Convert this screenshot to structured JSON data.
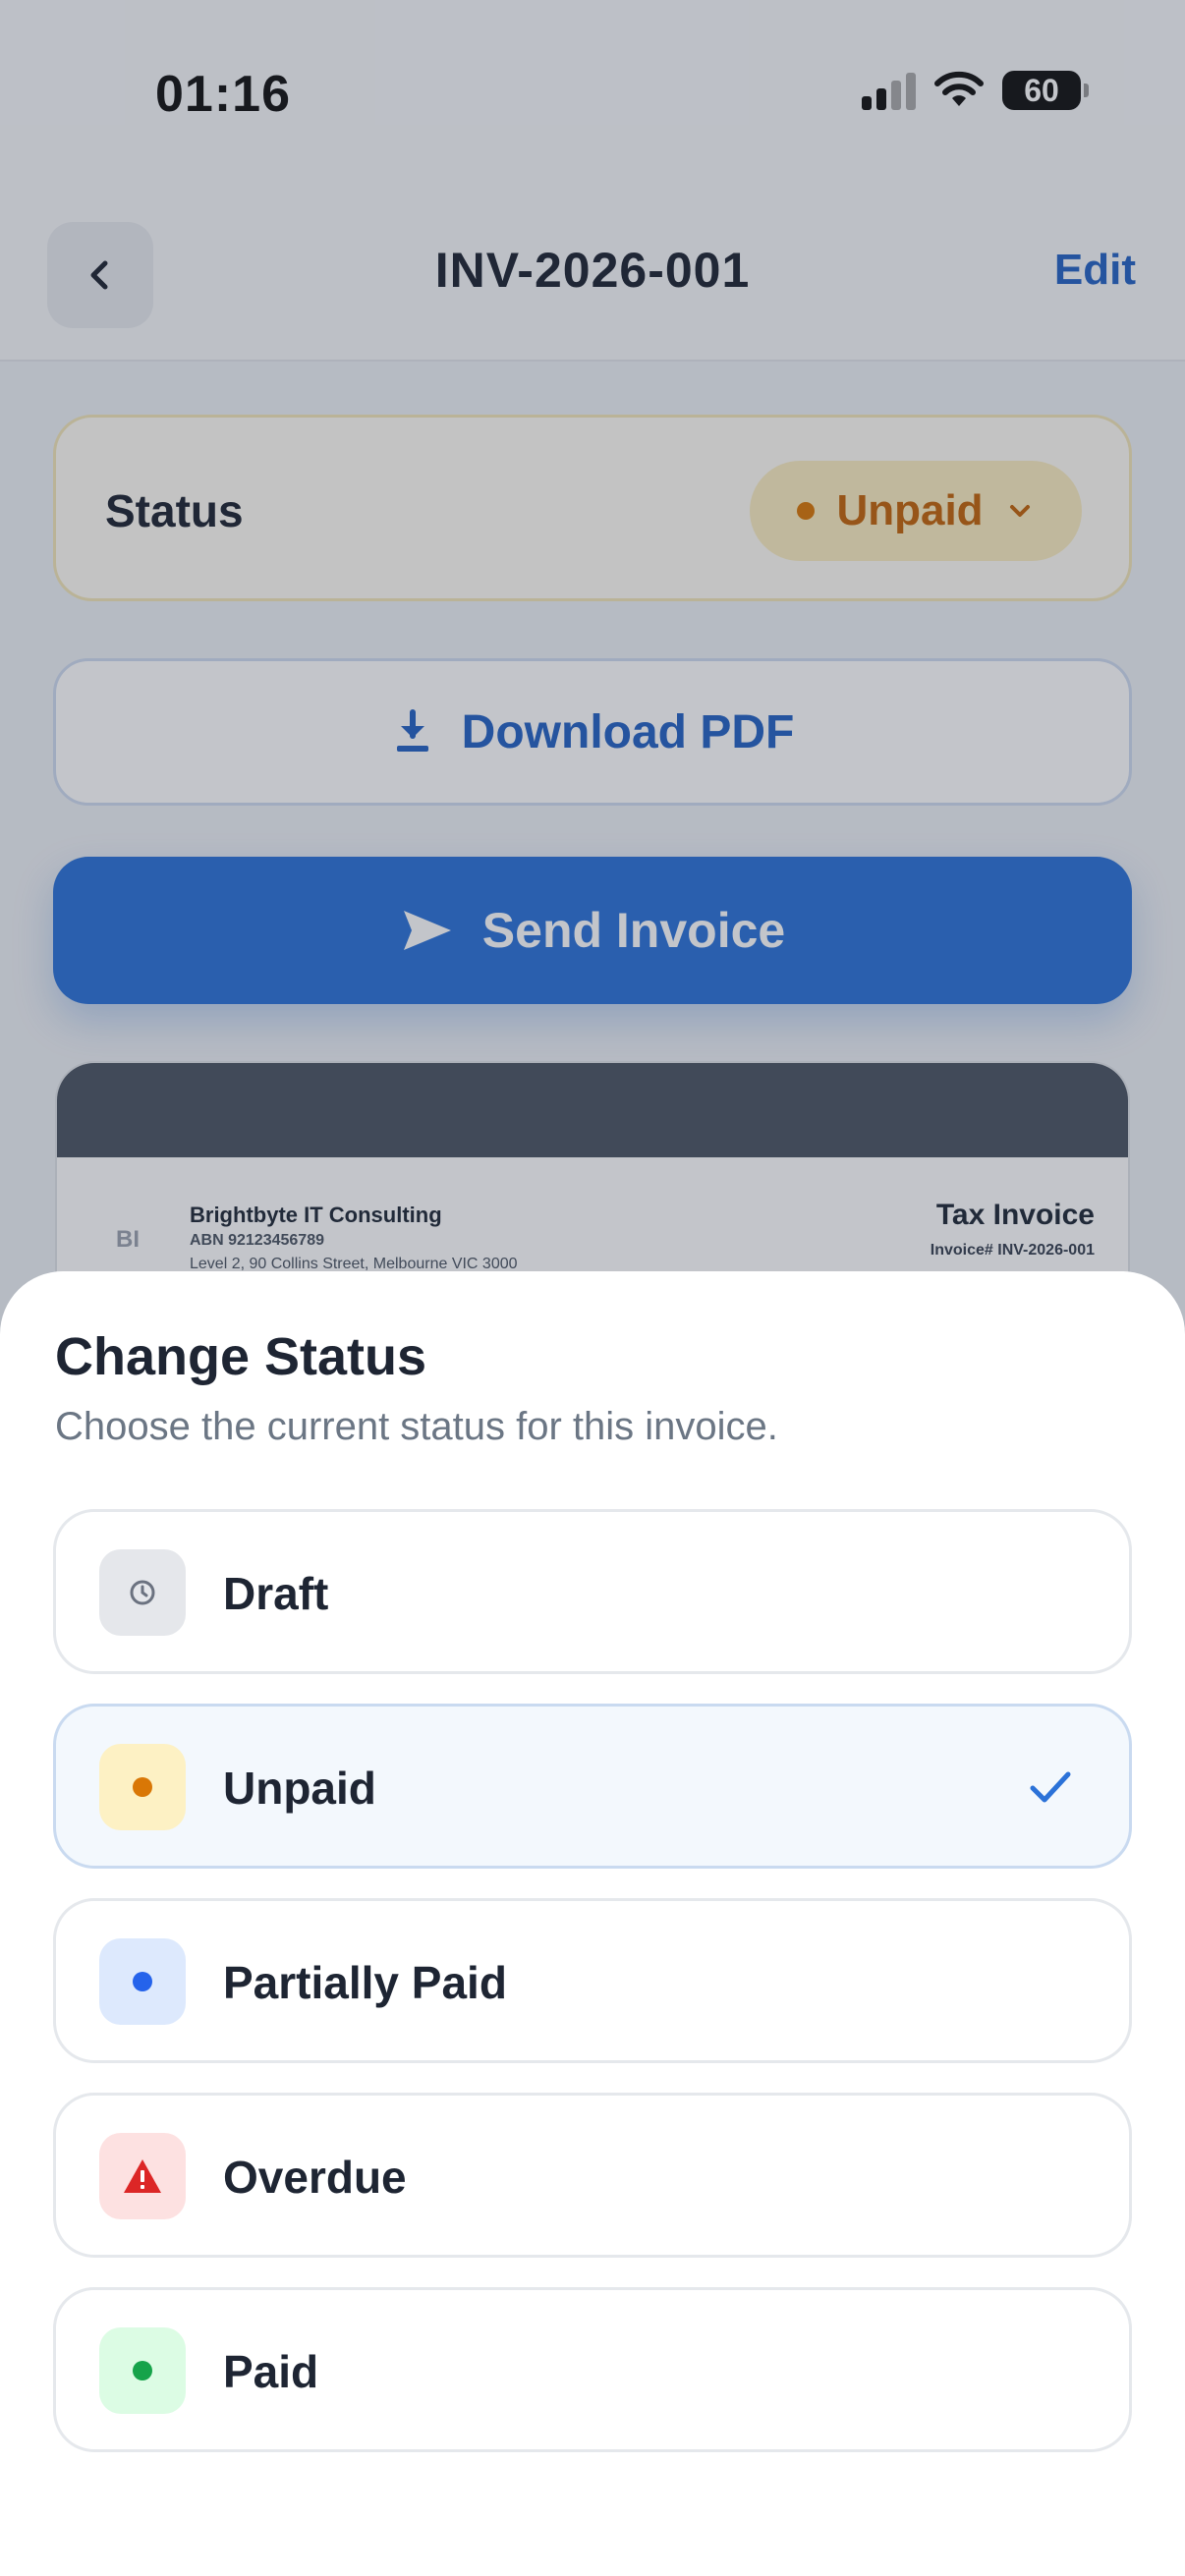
{
  "status_bar": {
    "time": "01:16",
    "battery": "60"
  },
  "nav": {
    "title": "INV-2026-001",
    "edit_label": "Edit",
    "back_icon": "chevron-left-icon"
  },
  "status_card": {
    "label": "Status",
    "value": "Unpaid",
    "accent": "#d97706"
  },
  "actions": {
    "download_label": "Download PDF",
    "send_label": "Send Invoice",
    "primary_color": "#2b72d8"
  },
  "preview": {
    "logo_initials": "BI",
    "company": "Brightbyte IT Consulting",
    "abn": "ABN 92123456789",
    "address": "Level 2, 90 Collins Street, Melbourne VIC 3000",
    "doc_title": "Tax Invoice",
    "invoice_number": "Invoice# INV-2026-001"
  },
  "sheet": {
    "title": "Change Status",
    "subtitle": "Choose the current status for this invoice.",
    "options": [
      {
        "label": "Draft",
        "icon": "clock-icon",
        "color": "#6b7280",
        "selected": false
      },
      {
        "label": "Unpaid",
        "icon": "dot-icon",
        "color": "#d97706",
        "selected": true
      },
      {
        "label": "Partially Paid",
        "icon": "dot-icon",
        "color": "#2563eb",
        "selected": false
      },
      {
        "label": "Overdue",
        "icon": "warning-icon",
        "color": "#dc2626",
        "selected": false
      },
      {
        "label": "Paid",
        "icon": "dot-icon",
        "color": "#16a34a",
        "selected": false
      }
    ]
  }
}
